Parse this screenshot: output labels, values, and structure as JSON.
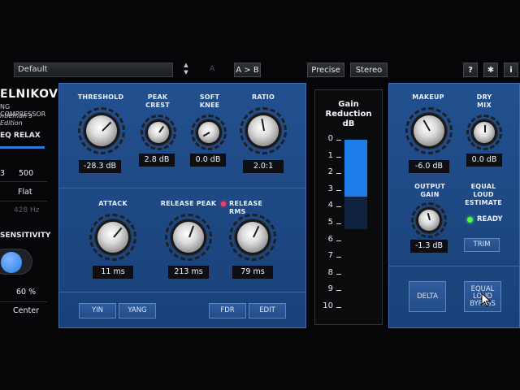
{
  "topbar": {
    "preset": "Default",
    "spin_up": "▲",
    "spin_down": "▼",
    "ab_a": "A",
    "ab_copy": "A > B",
    "precise": "Precise",
    "stereo": "Stereo",
    "help": "?",
    "settings": "✱",
    "info": "i"
  },
  "left": {
    "title": "ELNIKOV",
    "subtitle1": "NG COMPRESSOR",
    "subtitle2": "ntleman's Edition",
    "eq_relax": "EQ RELAX",
    "freq_low": "3",
    "freq_mid": "500",
    "curve": "Flat",
    "freq_hz": "428 Hz",
    "sensitivity": "SENSITIVITY",
    "percent": "60 %",
    "center": "Center"
  },
  "comp": {
    "threshold": {
      "label": "THRESHOLD",
      "value": "-28.3 dB"
    },
    "peak_crest": {
      "label1": "PEAK",
      "label2": "CREST",
      "value": "2.8 dB"
    },
    "soft_knee": {
      "label1": "SOFT",
      "label2": "KNEE",
      "value": "0.0 dB"
    },
    "ratio": {
      "label": "RATIO",
      "value": "2.0:1"
    },
    "attack": {
      "label": "ATTACK",
      "value": "11 ms"
    },
    "release_peak": {
      "label": "RELEASE PEAK",
      "value": "213 ms"
    },
    "release_rms": {
      "label": "RELEASE RMS",
      "value": "79 ms"
    },
    "yin": "YIN",
    "yang": "YANG",
    "fdr": "FDR",
    "edit": "EDIT"
  },
  "meter": {
    "title1": "Gain",
    "title2": "Reduction",
    "title3": "dB",
    "scale": [
      "0",
      "1",
      "2",
      "3",
      "4",
      "5",
      "6",
      "7",
      "8",
      "9",
      "10"
    ],
    "level_db": 3.4
  },
  "right": {
    "makeup": {
      "label": "MAKEUP",
      "value": "-6.0 dB"
    },
    "dry_mix": {
      "label1": "DRY",
      "label2": "MIX",
      "value": "0.0 dB"
    },
    "output_gain": {
      "label1": "OUTPUT",
      "label2": "GAIN",
      "value": "-1.3 dB"
    },
    "equal_loud": {
      "label1": "EQUAL",
      "label2": "LOUD",
      "label3": "ESTIMATE"
    },
    "ready": "READY",
    "trim": "TRIM",
    "delta": "DELTA",
    "bypass": {
      "l1": "EQUAL",
      "l2": "LOUD",
      "l3": "BYPASS"
    }
  },
  "colors": {
    "panel": "#1e4a86",
    "meter_fill": "#1d7ce6",
    "ready_led": "#4cff3c",
    "release_led": "#ff3b5c"
  }
}
